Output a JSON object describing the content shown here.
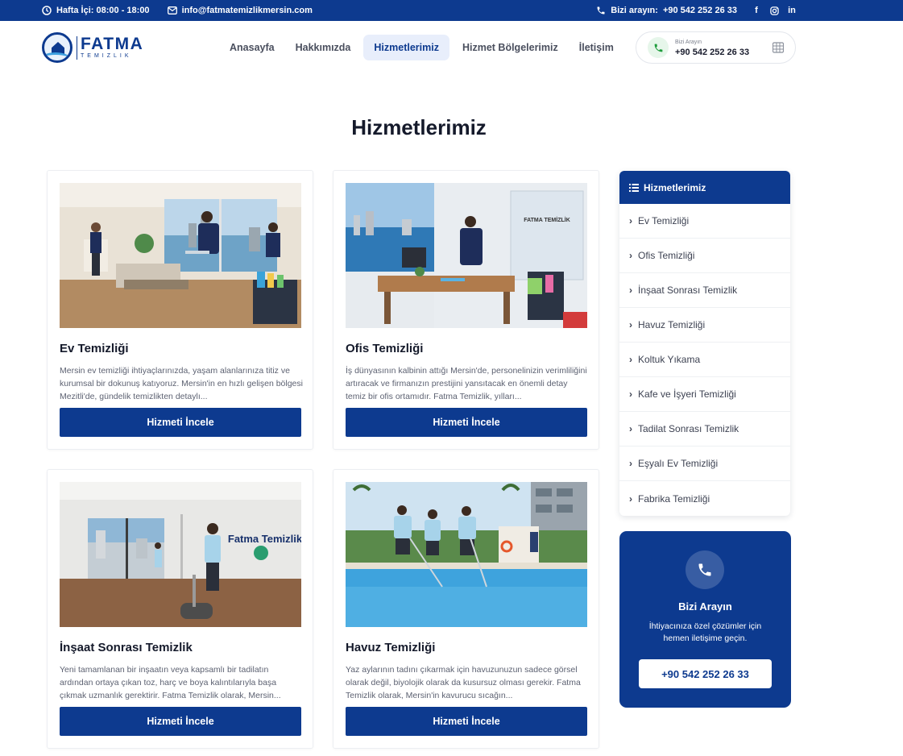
{
  "topbar": {
    "hours": "Hafta İçi: 08:00 - 18:00",
    "email": "info@fatmatemizlikmersin.com",
    "call_label": "Bizi arayın:",
    "call_number": "+90 542 252 26 33"
  },
  "logo": {
    "brand": "FATMA",
    "sub": "TEMIZLIK"
  },
  "nav": {
    "items": [
      {
        "label": "Anasayfa"
      },
      {
        "label": "Hakkımızda"
      },
      {
        "label": "Hizmetlerimiz"
      },
      {
        "label": "Hizmet Bölgelerimiz"
      },
      {
        "label": "İletişim"
      }
    ]
  },
  "callbox": {
    "small": "Bizi Arayın",
    "number": "+90 542 252 26 33"
  },
  "page": {
    "title": "Hizmetlerimiz"
  },
  "cards": [
    {
      "title": "Ev Temizliği",
      "text": "Mersin ev temizliği ihtiyaçlarınızda, yaşam alanlarınıza titiz ve kurumsal bir dokunuş katıyoruz. Mersin'in en hızlı gelişen bölgesi Mezitli'de, gündelik temizlikten detaylı...",
      "button": "Hizmeti İncele"
    },
    {
      "title": "Ofis Temizliği",
      "text": "İş dünyasının kalbinin attığı Mersin'de, personelinizin verimliliğini artıracak ve firmanızın prestijini yansıtacak en önemli detay temiz bir ofis ortamıdır. Fatma Temizlik, yılları...",
      "button": "Hizmeti İncele"
    },
    {
      "title": "İnşaat Sonrası Temizlik",
      "text": "Yeni tamamlanan bir inşaatın veya kapsamlı bir tadilatın ardından ortaya çıkan toz, harç ve boya kalıntılarıyla başa çıkmak uzmanlık gerektirir. Fatma Temizlik olarak, Mersin...",
      "button": "Hizmeti İncele"
    },
    {
      "title": "Havuz Temizliği",
      "text": "Yaz aylarının tadını çıkarmak için havuzunuzun sadece görsel olarak değil, biyolojik olarak da kusursuz olması gerekir. Fatma Temizlik olarak, Mersin'in kavurucu sıcağın...",
      "button": "Hizmeti İncele"
    }
  ],
  "images": {
    "office_sign": "FATMA TEMİZLİK",
    "wall_sign": "Fatma Temizlik"
  },
  "sidebar": {
    "title": "Hizmetlerimiz",
    "items": [
      {
        "label": "Ev Temizliği"
      },
      {
        "label": "Ofis Temizliği"
      },
      {
        "label": "İnşaat Sonrası Temizlik"
      },
      {
        "label": "Havuz Temizliği"
      },
      {
        "label": "Koltuk Yıkama"
      },
      {
        "label": "Kafe ve İşyeri Temizliği"
      },
      {
        "label": "Tadilat Sonrası Temizlik"
      },
      {
        "label": "Eşyalı Ev Temizliği"
      },
      {
        "label": "Fabrika Temizliği"
      }
    ]
  },
  "callcard": {
    "title": "Bizi Arayın",
    "desc": "İhtiyacınıza özel çözümler için hemen iletişime geçin.",
    "number": "+90 542 252 26 33"
  },
  "icons": {
    "clock": "clock-icon",
    "mail": "mail-icon",
    "phone": "phone-icon",
    "facebook": "facebook-icon",
    "instagram": "instagram-icon",
    "linkedin": "linkedin-icon",
    "grid": "grid-icon",
    "list": "list-icon",
    "chevron": "chevron-right-icon"
  },
  "colors": {
    "primary": "#0d3a8f",
    "text": "#151a2b",
    "muted": "#5d6272",
    "green": "#1f9d3d"
  }
}
